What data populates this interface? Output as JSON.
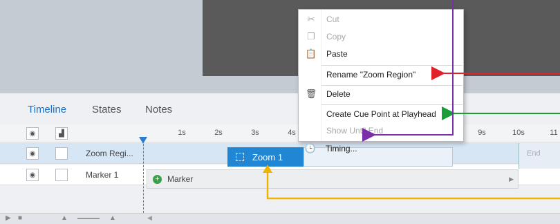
{
  "timeline": {
    "tabs": [
      {
        "label": "Timeline"
      },
      {
        "label": "States"
      },
      {
        "label": "Notes"
      }
    ],
    "ruler_ticks": [
      "1s",
      "2s",
      "3s",
      "4s",
      "9s",
      "10s",
      "11"
    ],
    "tracks": [
      {
        "label": "Zoom Regi..."
      },
      {
        "label": "Marker 1"
      }
    ],
    "zoom_clip_label": "Zoom 1",
    "marker_label": "Marker",
    "end_label": "End"
  },
  "context_menu": {
    "items": [
      {
        "label": "Cut",
        "icon": "scissors-icon",
        "enabled": false
      },
      {
        "label": "Copy",
        "icon": "copy-icon",
        "enabled": false
      },
      {
        "label": "Paste",
        "icon": "clipboard-icon",
        "enabled": true
      },
      {
        "label": "Rename \"Zoom Region\"",
        "icon": "",
        "enabled": true
      },
      {
        "label": "Delete",
        "icon": "trash-icon",
        "enabled": true
      },
      {
        "label": "Create Cue Point at Playhead",
        "icon": "",
        "enabled": true
      },
      {
        "label": "Show Until End",
        "icon": "",
        "enabled": false
      },
      {
        "label": "Timing...",
        "icon": "clock-icon",
        "enabled": true
      }
    ]
  },
  "colors": {
    "accent": "#2186d4",
    "arrow_red": "#e0202a",
    "arrow_green": "#1a9e3a",
    "arrow_purple": "#7a2ea8",
    "arrow_yellow": "#f0b400"
  }
}
